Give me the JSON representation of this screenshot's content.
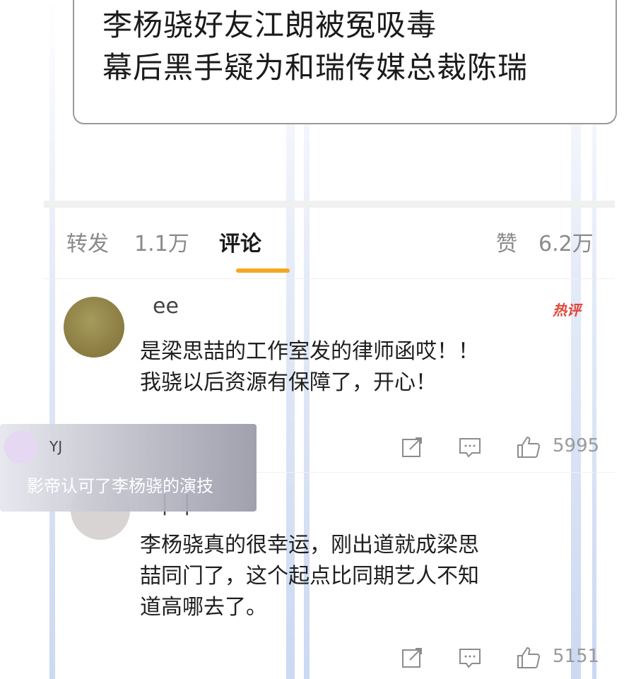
{
  "headline": {
    "line1": "李杨骁好友江朗被冤吸毒",
    "line2": "幕后黑手疑为和瑞传媒总裁陈瑞"
  },
  "tabs": {
    "forward_label": "转发",
    "forward_count": "1.1万",
    "comments_label": "评论",
    "likes_label": "赞",
    "likes_count": "6.2万"
  },
  "comments": [
    {
      "username": "ee",
      "badge": "热评",
      "text_line1": "是梁思喆的工作室发的律师函哎！！",
      "text_line2": "我骁以后资源有保障了，开心！",
      "like_count": "5995"
    },
    {
      "username": "| |",
      "text_line1": "李杨骁真的很幸运，刚出道就成梁思",
      "text_line2": "喆同门了，这个起点比同期艺人不知",
      "text_line3": "道高哪去了。",
      "like_count": "5151"
    }
  ],
  "toast": {
    "name": "YJ",
    "message": "影帝认可了李杨骁的演技"
  },
  "icons": [
    "share-icon",
    "comment-icon",
    "like-icon"
  ],
  "colors": {
    "accent": "#f5a623",
    "hot": "#e0463a"
  }
}
